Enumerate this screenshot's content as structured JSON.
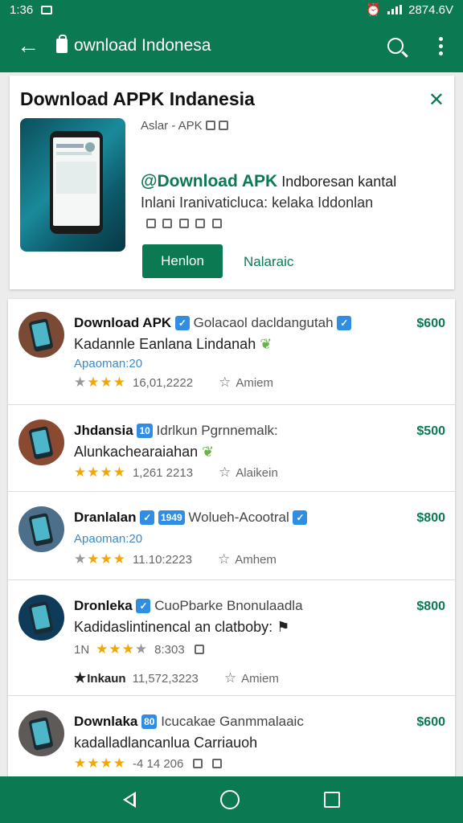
{
  "status": {
    "time": "1:36",
    "right": "2874.6V"
  },
  "appbar": {
    "query": "ownload Indonesa"
  },
  "promo": {
    "title": "Download APPK Indanesia",
    "meta": "Aslar - APK",
    "headline_bold": "@Download APK",
    "headline_rest": " Indboresan kantal",
    "desc": "Inlani Iranivaticluca: kelaka Iddonlan",
    "primary_button": "Henlon",
    "secondary_link": "Nalaraic"
  },
  "list": [
    {
      "name": "Download APK",
      "badge": "",
      "sub": "Golacaol dacldangutah",
      "price": "$600",
      "line2": "Kadannle Eanlana Lindanah",
      "line3": "Apaoman:20",
      "stars": 4,
      "rating_text": "16,01,2222",
      "action": "Amiem",
      "avatar_color": "#7a4a35"
    },
    {
      "name": "Jhdansia",
      "badge": "10",
      "sub": "Idrlkun Pgrnnemalk:",
      "price": "$500",
      "line2": "Alunkachearaiahan",
      "line3": "",
      "stars": 4,
      "rating_text": "1,261 2213",
      "action": "Alaikein",
      "avatar_color": "#8a4a32"
    },
    {
      "name": "Dranlalan",
      "badge": "1949",
      "sub": "Wolueh-Acootral",
      "price": "$800",
      "line2": "",
      "line3": "Apaoman:20",
      "stars": 3,
      "rating_text": "11.10:2223",
      "action": "Amhem",
      "avatar_color": "#4d6f8a"
    },
    {
      "name": "Dronleka",
      "badge": "",
      "sub": "CuoPbarke Bnonulaadla",
      "price": "$800",
      "line2": "Kadidaslintinencal an clatboby:",
      "line3": "",
      "stars": 3,
      "rating_text": "8:303",
      "action": "Amiem",
      "extra_label": "Inkaun",
      "extra_value": "11,572,3223",
      "prefix": "1N",
      "avatar_color": "#0e3b59"
    },
    {
      "name": "Downlaka",
      "badge": "80",
      "sub": "Icucakae Ganmmalaaic",
      "price": "$600",
      "line2": "kadalladlancanlua Carriauoh",
      "line3": "",
      "stars": 4,
      "rating_text": "-4 14 206",
      "action": "",
      "avatar_color": "#5d5a58"
    }
  ],
  "colors": {
    "primary": "#0b7a52",
    "accent_blue": "#2f8ee3",
    "star": "#f2a800"
  }
}
